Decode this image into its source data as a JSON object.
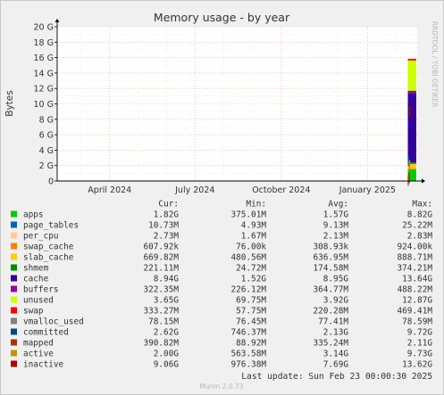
{
  "chart_data": {
    "type": "area",
    "title": "Memory usage - by year",
    "ylabel": "Bytes",
    "side_label": "RRDTOOL / TOBI OETIKER",
    "y_unit": "bytes",
    "ylim": [
      0,
      20
    ],
    "yticks": [
      "0",
      "2 G",
      "4 G",
      "6 G",
      "8 G",
      "10 G",
      "12 G",
      "14 G",
      "16 G",
      "18 G",
      "20 G"
    ],
    "xticks": [
      "April 2024",
      "July 2024",
      "October 2024",
      "January 2025"
    ],
    "xtick_dates": [
      "2024-04-01",
      "2024-07-01",
      "2024-10-01",
      "2025-01-01"
    ],
    "x_range": [
      "2024-02-05",
      "2025-02-23"
    ],
    "data_start": "2025-02-13",
    "grid": true,
    "legend_header": [
      "Cur:",
      "Min:",
      "Avg:",
      "Max:"
    ],
    "series": [
      {
        "name": "apps",
        "color": "#00cc00",
        "cur": "1.82G",
        "min": "375.01M",
        "avg": "1.57G",
        "max": "8.82G"
      },
      {
        "name": "page_tables",
        "color": "#0066b3",
        "cur": "10.73M",
        "min": "4.93M",
        "avg": "9.13M",
        "max": "25.22M"
      },
      {
        "name": "per_cpu",
        "color": "#ffcc99",
        "cur": "2.73M",
        "min": "1.67M",
        "avg": "2.13M",
        "max": "2.83M"
      },
      {
        "name": "swap_cache",
        "color": "#ff8000",
        "cur": "607.92k",
        "min": "76.00k",
        "avg": "308.93k",
        "max": "924.00k"
      },
      {
        "name": "slab_cache",
        "color": "#ffcc00",
        "cur": "669.82M",
        "min": "480.56M",
        "avg": "636.95M",
        "max": "888.71M"
      },
      {
        "name": "shmem",
        "color": "#008f00",
        "cur": "221.11M",
        "min": "24.72M",
        "avg": "174.58M",
        "max": "374.21M"
      },
      {
        "name": "cache",
        "color": "#330099",
        "cur": "8.94G",
        "min": "1.52G",
        "avg": "8.95G",
        "max": "13.64G"
      },
      {
        "name": "buffers",
        "color": "#990099",
        "cur": "322.35M",
        "min": "226.12M",
        "avg": "364.77M",
        "max": "488.22M"
      },
      {
        "name": "unused",
        "color": "#ccff00",
        "cur": "3.65G",
        "min": "69.75M",
        "avg": "3.92G",
        "max": "12.87G"
      },
      {
        "name": "swap",
        "color": "#ff0000",
        "cur": "333.27M",
        "min": "57.75M",
        "avg": "220.28M",
        "max": "469.41M"
      },
      {
        "name": "vmalloc_used",
        "color": "#808080",
        "cur": "78.15M",
        "min": "76.45M",
        "avg": "77.41M",
        "max": "78.59M"
      },
      {
        "name": "committed",
        "color": "#004b7b",
        "cur": "2.62G",
        "min": "746.37M",
        "avg": "2.13G",
        "max": "9.72G"
      },
      {
        "name": "mapped",
        "color": "#a63200",
        "cur": "390.82M",
        "min": "88.92M",
        "avg": "335.24M",
        "max": "2.11G"
      },
      {
        "name": "active",
        "color": "#c49300",
        "cur": "2.00G",
        "min": "563.58M",
        "avg": "3.14G",
        "max": "9.73G"
      },
      {
        "name": "inactive",
        "color": "#b00000",
        "cur": "9.06G",
        "min": "976.38M",
        "avg": "7.69G",
        "max": "13.62G"
      }
    ],
    "last_update": "Last update: Sun Feb 23 00:00:30 2025",
    "footer": "Munin 2.0.73"
  }
}
